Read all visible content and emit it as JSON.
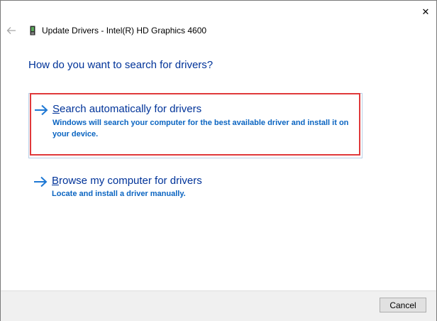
{
  "window": {
    "title": "Update Drivers - Intel(R) HD Graphics 4600",
    "close_glyph": "✕"
  },
  "icons": {
    "back": "back-arrow-icon",
    "device": "graphics-card-icon",
    "option_arrow": "right-arrow-icon",
    "close": "close-icon"
  },
  "main": {
    "heading": "How do you want to search for drivers?",
    "options": [
      {
        "title_accel": "S",
        "title_rest": "earch automatically for drivers",
        "description": "Windows will search your computer for the best available driver and install it on your device.",
        "selected": true
      },
      {
        "title_accel": "B",
        "title_rest": "rowse my computer for drivers",
        "description": "Locate and install a driver manually.",
        "selected": false
      }
    ]
  },
  "footer": {
    "cancel_label": "Cancel"
  },
  "colors": {
    "heading": "#003399",
    "link": "#003399",
    "description": "#0a64c1",
    "highlight": "#e0393b",
    "footer_bg": "#f0f0f0"
  }
}
